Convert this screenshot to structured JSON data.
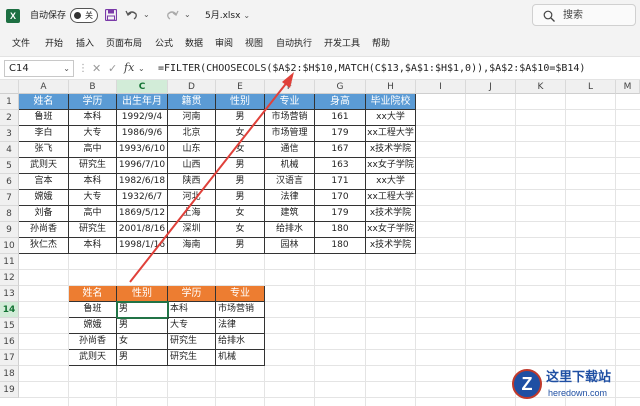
{
  "titlebar": {
    "app_icon_letter": "X",
    "autosave_label": "自动保存",
    "autosave_toggle": "关",
    "filename": "5月.xlsx",
    "search_placeholder": "搜索"
  },
  "menu": [
    "文件",
    "开始",
    "插入",
    "页面布局",
    "公式",
    "数据",
    "审阅",
    "视图",
    "自动执行",
    "开发工具",
    "帮助"
  ],
  "formula_bar": {
    "name_box": "C14",
    "fx": "fx",
    "formula": "=FILTER(CHOOSECOLS($A$2:$H$10,MATCH(C$13,$A$1:$H$1,0)),$A$2:$A$10=$B14)"
  },
  "columns": [
    "A",
    "B",
    "C",
    "D",
    "E",
    "F",
    "G",
    "H",
    "I",
    "J",
    "K",
    "L",
    "M"
  ],
  "rows": [
    "1",
    "2",
    "3",
    "4",
    "5",
    "6",
    "7",
    "8",
    "9",
    "10",
    "11",
    "12",
    "13",
    "14",
    "15",
    "16",
    "17",
    "18",
    "19"
  ],
  "selected": {
    "row": "14",
    "col": "C"
  },
  "table1": {
    "headers": [
      "姓名",
      "学历",
      "出生年月",
      "籍贯",
      "性别",
      "专业",
      "身高",
      "毕业院校"
    ],
    "rows": [
      [
        "鲁班",
        "本科",
        "1992/9/4",
        "河南",
        "男",
        "市场营销",
        "161",
        "xx大学"
      ],
      [
        "李白",
        "大专",
        "1986/9/6",
        "北京",
        "女",
        "市场管理",
        "179",
        "xx工程大学"
      ],
      [
        "张飞",
        "高中",
        "1993/6/10",
        "山东",
        "女",
        "通信",
        "167",
        "x技术学院"
      ],
      [
        "武则天",
        "研究生",
        "1996/7/10",
        "山西",
        "男",
        "机械",
        "163",
        "xx女子学院"
      ],
      [
        "宫本",
        "本科",
        "1982/6/18",
        "陕西",
        "男",
        "汉语言",
        "171",
        "xx大学"
      ],
      [
        "嫦娥",
        "大专",
        "1932/6/7",
        "河北",
        "男",
        "法律",
        "170",
        "xx工程大学"
      ],
      [
        "刘备",
        "高中",
        "1869/5/12",
        "上海",
        "女",
        "建筑",
        "179",
        "x技术学院"
      ],
      [
        "孙尚香",
        "研究生",
        "2001/8/16",
        "深圳",
        "女",
        "给排水",
        "180",
        "xx女子学院"
      ],
      [
        "狄仁杰",
        "本科",
        "1998/1/16",
        "海南",
        "男",
        "园林",
        "180",
        "x技术学院"
      ]
    ]
  },
  "table2": {
    "headers": [
      "姓名",
      "性别",
      "学历",
      "专业"
    ],
    "rows": [
      [
        "鲁班",
        "男",
        "本科",
        "市场营销"
      ],
      [
        "嫦娥",
        "男",
        "大专",
        "法律"
      ],
      [
        "孙尚香",
        "女",
        "研究生",
        "给排水"
      ],
      [
        "武则天",
        "男",
        "研究生",
        "机械"
      ]
    ]
  },
  "watermark": {
    "logo": "Z",
    "title": "这里下载站",
    "url": "heredown.com"
  },
  "colors": {
    "header_blue": "#5b9bd5",
    "header_orange": "#ed7d31",
    "excel_green": "#217346",
    "arrow_red": "#e0413a"
  }
}
